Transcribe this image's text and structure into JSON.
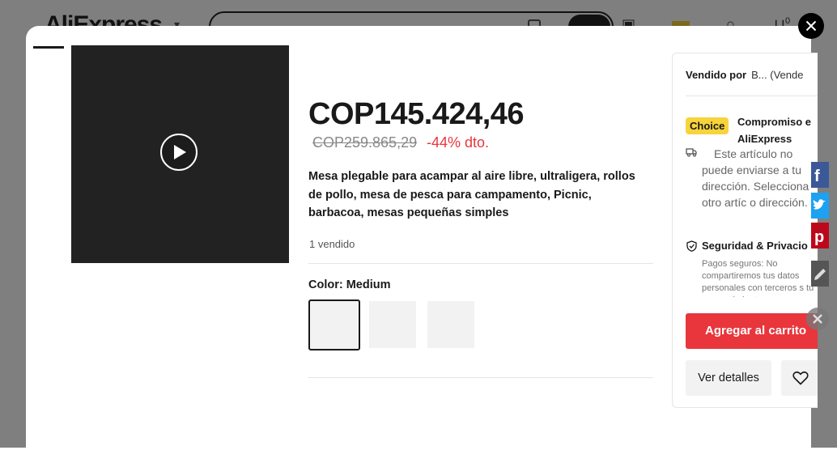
{
  "background": {
    "logo": "AliExpress",
    "cart_count": "0"
  },
  "product": {
    "price": "COP145.424,46",
    "old_price": "COP259.865,29",
    "discount": "-44% dto.",
    "title": "Mesa plegable para acampar al aire libre, ultraligera, rollos de pollo, mesa de pesca para campamento, Picnic, barbacoa, mesas pequeñas simples",
    "sold": "1 vendido",
    "color_label": "Color: Medium",
    "swatches": [
      "",
      "",
      ""
    ]
  },
  "side": {
    "sold_by_label": "Vendido por",
    "seller_name": "B... (Vende",
    "choice_badge": "Choice",
    "commitment_line1": "Compromiso e",
    "commitment_line2": "AliExpress",
    "shipping_text": "Este artículo no puede enviarse a tu dirección. Selecciona otro artíc o dirección.",
    "security_title": "Seguridad & Privacio",
    "security_desc": "Pagos seguros: No compartiremos tus datos personales con terceros s tu consentimiento.",
    "add_to_cart": "Agregar al carrito",
    "view_details": "Ver detalles"
  },
  "colors": {
    "accent_red": "#e8363c",
    "choice_yellow": "#f7d33c",
    "text": "#191919"
  },
  "icons": [
    "play-icon",
    "truck-icon",
    "shield-icon",
    "heart-icon",
    "close-icon",
    "facebook-icon",
    "twitter-icon",
    "pinterest-icon",
    "edit-icon"
  ]
}
